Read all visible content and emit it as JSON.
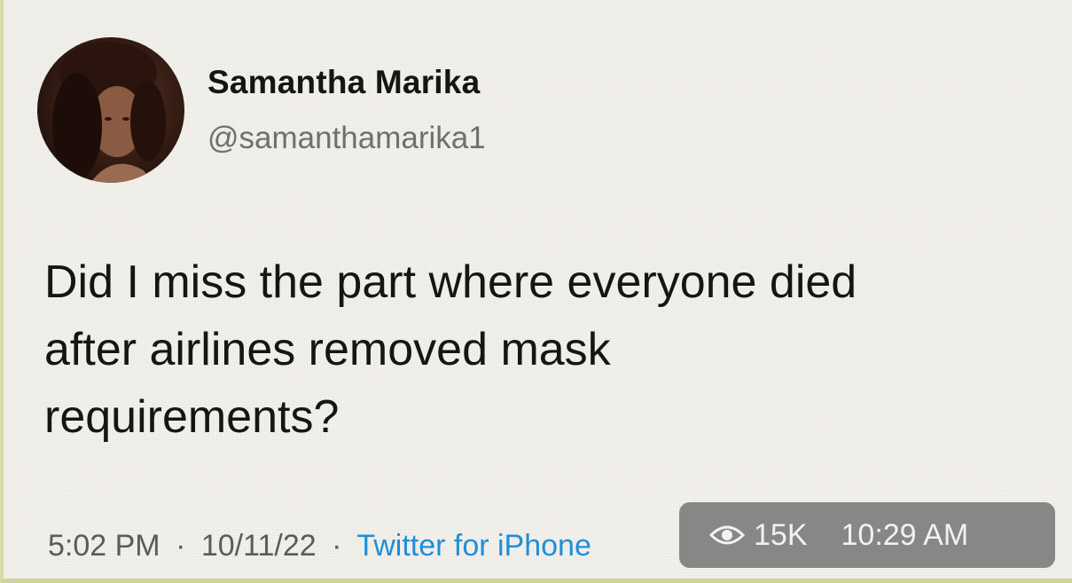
{
  "tweet": {
    "author_name": "Samantha Marika",
    "author_handle": "@samanthamarika1",
    "text_lines": [
      "Did I miss the part where everyone died",
      "after airlines removed mask",
      "requirements?"
    ],
    "time": "5:02 PM",
    "date": "10/11/22",
    "separator": "·",
    "source": "Twitter for iPhone"
  },
  "overlay": {
    "views": "15K",
    "clock": "10:29 AM",
    "icon": "eye-icon"
  },
  "colors": {
    "source_link": "#1d8fd8",
    "handle": "#6f6f6f",
    "text": "#151515"
  }
}
